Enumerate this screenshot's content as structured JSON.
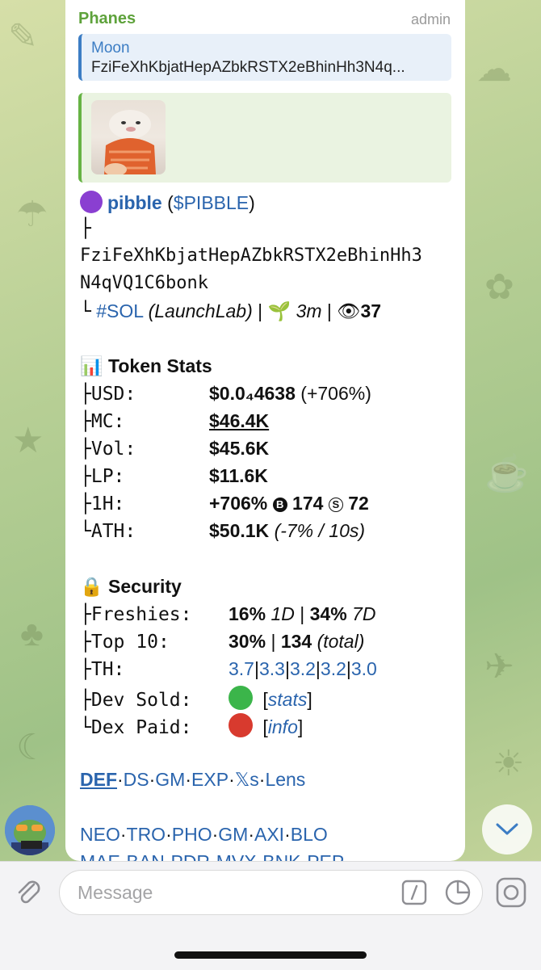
{
  "message": {
    "sender": "Phanes",
    "badge": "admin",
    "reply": {
      "title": "Moon",
      "text": "FziFeXhKbjatHepAZbkRSTX2eBhinHh3N4q..."
    },
    "token": {
      "name": "pibble",
      "ticker_open": " (",
      "ticker": "$PIBBLE",
      "ticker_close": ")",
      "tree_top": "├",
      "address_line1": "FziFeXhKbjatHepAZbkRSTX2eBhinHh3",
      "address_line2": "N4qVQ1C6bonk",
      "tree_end": "└",
      "chain": "#SOL",
      "platform": "(LaunchLab)",
      "sep": " | ",
      "age": "3m",
      "views": "37"
    },
    "stats": {
      "title": "Token Stats",
      "rows": [
        {
          "tree": "├",
          "label": "USD:",
          "value": "$0.0₄4638",
          "extra": " (+706%)"
        },
        {
          "tree": "├",
          "label": "MC:",
          "value": "$46.4K"
        },
        {
          "tree": "├",
          "label": "Vol:",
          "value": "$45.6K"
        },
        {
          "tree": "├",
          "label": "LP:",
          "value": "$11.6K"
        },
        {
          "tree": "├",
          "label": "1H:",
          "value": "+706%",
          "buys_icon": "B",
          "buys": "174",
          "sells_icon": "S",
          "sells": "72"
        },
        {
          "tree": "└",
          "label": "ATH:",
          "value": "$50.1K",
          "extra": "(-7% / 10s)"
        }
      ]
    },
    "security": {
      "title": "Security",
      "freshies_tree": "├",
      "freshies_label": "Freshies:",
      "freshies_1d": "16%",
      "freshies_1d_unit": "1D",
      "bar": "|",
      "freshies_7d": "34%",
      "freshies_7d_unit": "7D",
      "top10_tree": "├",
      "top10_label": "Top 10:",
      "top10_pct": "30%",
      "top10_count": "134",
      "top10_unit": "(total)",
      "th_tree": "├",
      "th_label": "TH:",
      "th_values": [
        "3.7",
        "3.3",
        "3.2",
        "3.2",
        "3.0"
      ],
      "dev_tree": "├",
      "dev_label": "Dev Sold:",
      "dev_status_color": "#3bb54a",
      "dev_link": "stats",
      "dex_tree": "└",
      "dex_label": "Dex Paid:",
      "dex_status_color": "#d83a2e",
      "dex_link": "info",
      "bracket_open": "[",
      "bracket_close": "]"
    },
    "links_row1": [
      "DEF",
      "DS",
      "GM",
      "EXP",
      "𝕏s",
      "Lens"
    ],
    "links_row2": [
      "NEO",
      "TRO",
      "PHO",
      "GM",
      "AXI",
      "BLO"
    ],
    "links_row3": [
      "MAE",
      "BAN",
      "PDR",
      "MVX",
      "BNK",
      "PEP"
    ],
    "link_sep": "·"
  },
  "input": {
    "placeholder": "Message"
  },
  "colors": {
    "accent": "#2a64ad",
    "sender": "#5ea23b",
    "token_dot": "#8a3fd1"
  },
  "icons": [
    "attach-icon",
    "command-icon",
    "sticker-icon",
    "camera-icon",
    "chevron-down-icon",
    "chart-icon",
    "lock-icon",
    "sprout-icon",
    "eye-icon"
  ]
}
